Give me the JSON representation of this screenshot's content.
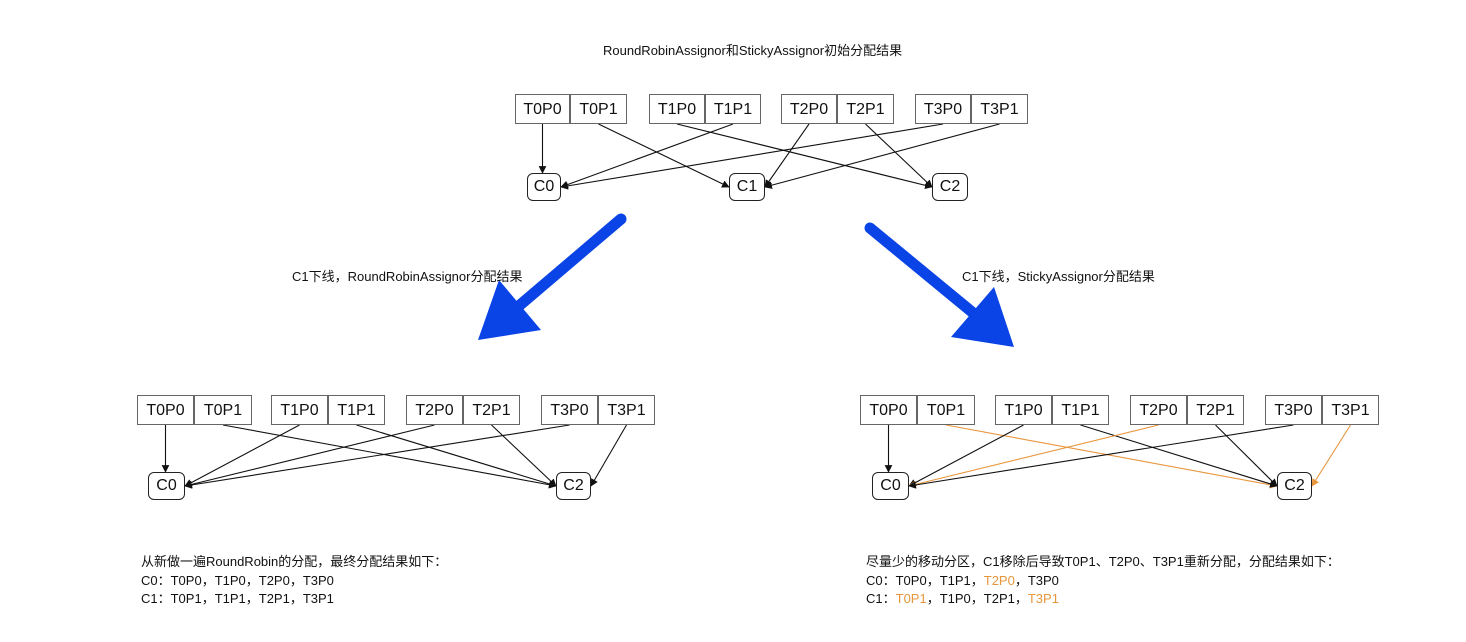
{
  "titles": {
    "top": "RoundRobinAssignor和StickyAssignor初始分配结果",
    "left": "C1下线，RoundRobinAssignor分配结果",
    "right": "C1下线，StickyAssignor分配结果"
  },
  "colors": {
    "bigArrow": "#0a43e6",
    "highlight": "#e8963c",
    "line": "#111111"
  },
  "diagrams": {
    "top": {
      "partitions": [
        "T0P0",
        "T0P1",
        "T1P0",
        "T1P1",
        "T2P0",
        "T2P1",
        "T3P0",
        "T3P1"
      ],
      "consumers": [
        "C0",
        "C1",
        "C2"
      ],
      "edges": [
        {
          "from": "T0P0",
          "to": "C0"
        },
        {
          "from": "T0P1",
          "to": "C1"
        },
        {
          "from": "T1P0",
          "to": "C2"
        },
        {
          "from": "T1P1",
          "to": "C0"
        },
        {
          "from": "T2P0",
          "to": "C1"
        },
        {
          "from": "T2P1",
          "to": "C2"
        },
        {
          "from": "T3P0",
          "to": "C0"
        },
        {
          "from": "T3P1",
          "to": "C1"
        }
      ]
    },
    "left": {
      "partitions": [
        "T0P0",
        "T0P1",
        "T1P0",
        "T1P1",
        "T2P0",
        "T2P1",
        "T3P0",
        "T3P1"
      ],
      "consumers": [
        "C0",
        "C2"
      ],
      "edges": [
        {
          "from": "T0P0",
          "to": "C0"
        },
        {
          "from": "T0P1",
          "to": "C2"
        },
        {
          "from": "T1P0",
          "to": "C0"
        },
        {
          "from": "T1P1",
          "to": "C2"
        },
        {
          "from": "T2P0",
          "to": "C0"
        },
        {
          "from": "T2P1",
          "to": "C2"
        },
        {
          "from": "T3P0",
          "to": "C0"
        },
        {
          "from": "T3P1",
          "to": "C2"
        }
      ]
    },
    "right": {
      "partitions": [
        "T0P0",
        "T0P1",
        "T1P0",
        "T1P1",
        "T2P0",
        "T2P1",
        "T3P0",
        "T3P1"
      ],
      "consumers": [
        "C0",
        "C2"
      ],
      "edges": [
        {
          "from": "T0P0",
          "to": "C0"
        },
        {
          "from": "T0P1",
          "to": "C2",
          "highlight": true
        },
        {
          "from": "T1P0",
          "to": "C0"
        },
        {
          "from": "T1P1",
          "to": "C2"
        },
        {
          "from": "T2P0",
          "to": "C0",
          "highlight": true
        },
        {
          "from": "T2P1",
          "to": "C2"
        },
        {
          "from": "T3P0",
          "to": "C0"
        },
        {
          "from": "T3P1",
          "to": "C2",
          "highlight": true
        }
      ]
    }
  },
  "summaries": {
    "left": {
      "heading": "从新做一遍RoundRobin的分配，最终分配结果如下：",
      "lines": [
        [
          {
            "t": "C0：T0P0，T1P0，T2P0，T3P0"
          }
        ],
        [
          {
            "t": "C1：T0P1，T1P1，T2P1，T3P1"
          }
        ]
      ]
    },
    "right": {
      "heading": "尽量少的移动分区，C1移除后导致T0P1、T2P0、T3P1重新分配，分配结果如下：",
      "lines": [
        [
          {
            "t": "C0：T0P0，T1P1，"
          },
          {
            "t": "T2P0",
            "hl": true
          },
          {
            "t": "，T3P0"
          }
        ],
        [
          {
            "t": "C1："
          },
          {
            "t": "T0P1",
            "hl": true
          },
          {
            "t": "，T1P0，T2P1，"
          },
          {
            "t": "T3P1",
            "hl": true
          }
        ]
      ]
    }
  }
}
